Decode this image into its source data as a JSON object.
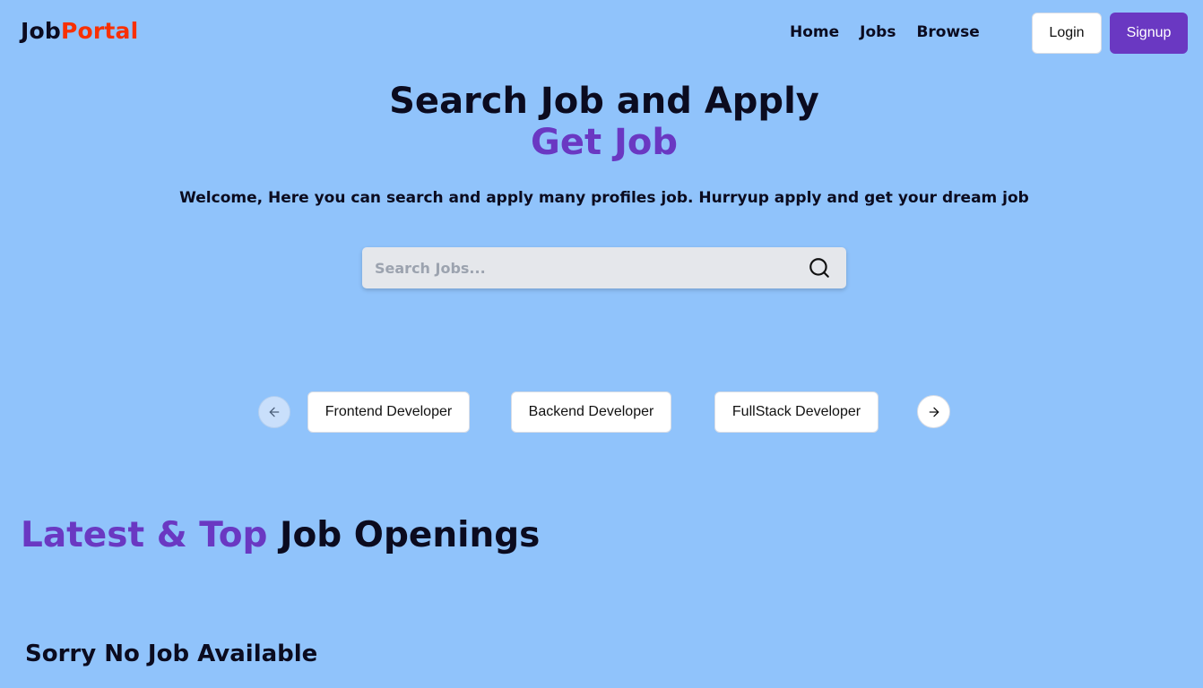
{
  "navbar": {
    "logo_part1": "Job",
    "logo_part2": "Portal",
    "links": [
      "Home",
      "Jobs",
      "Browse"
    ],
    "login_label": "Login",
    "signup_label": "Signup"
  },
  "hero": {
    "title_line1": "Search Job and Apply",
    "title_line2": "Get Job",
    "subtitle": "Welcome, Here you can search and apply many profiles job. Hurryup apply and get your dream job"
  },
  "search": {
    "placeholder": "Search Jobs...",
    "value": "",
    "icon": "search-icon"
  },
  "carousel": {
    "prev_icon": "arrow-left-icon",
    "next_icon": "arrow-right-icon",
    "items": [
      "Frontend Developer",
      "Backend Developer",
      "FullStack Developer"
    ]
  },
  "latest": {
    "heading_accent": "Latest & Top",
    "heading_rest": "Job Openings",
    "empty_message": "Sorry No Job Available"
  },
  "colors": {
    "background": "#90c3fb",
    "accent": "#6a38c2",
    "logo_accent": "#f83002",
    "text": "#0b0b1f"
  }
}
